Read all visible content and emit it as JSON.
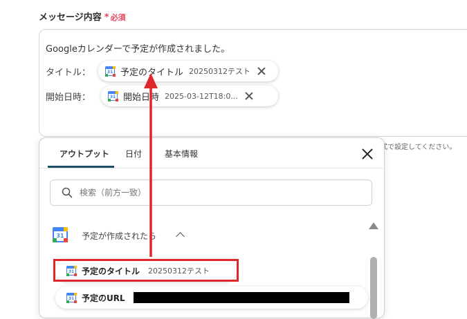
{
  "field": {
    "label": "メッセージ内容",
    "required_star": "*",
    "required_text": "必須"
  },
  "message": {
    "line1": "Googleカレンダーで予定が作成されました。",
    "title_row_label": "タイトル：",
    "start_row_label": "開始日時：",
    "chip_title": {
      "label": "予定のタイトル",
      "value": "20250312テスト",
      "icon": "google-calendar-icon"
    },
    "chip_start": {
      "label": "開始日時",
      "value": "2025-03-12T18:0...",
      "icon": "google-calendar-icon"
    }
  },
  "hint": "形式で設定してください。",
  "panel": {
    "tabs": [
      {
        "label": "アウトプット",
        "active": true
      },
      {
        "label": "日付",
        "active": false
      },
      {
        "label": "基本情報",
        "active": false
      }
    ],
    "search_placeholder": "検索（前方一致）",
    "group_title": "予定が作成されたら",
    "calendar_day": "31",
    "items": [
      {
        "label": "予定のタイトル",
        "value": "20250312テスト"
      },
      {
        "label": "予定のURL",
        "value": ""
      }
    ]
  },
  "colors": {
    "accent_red": "#e0262a",
    "required_red": "#e8455c",
    "tab_underline": "#1f4e6b",
    "gcal_blue": "#4285f4"
  }
}
